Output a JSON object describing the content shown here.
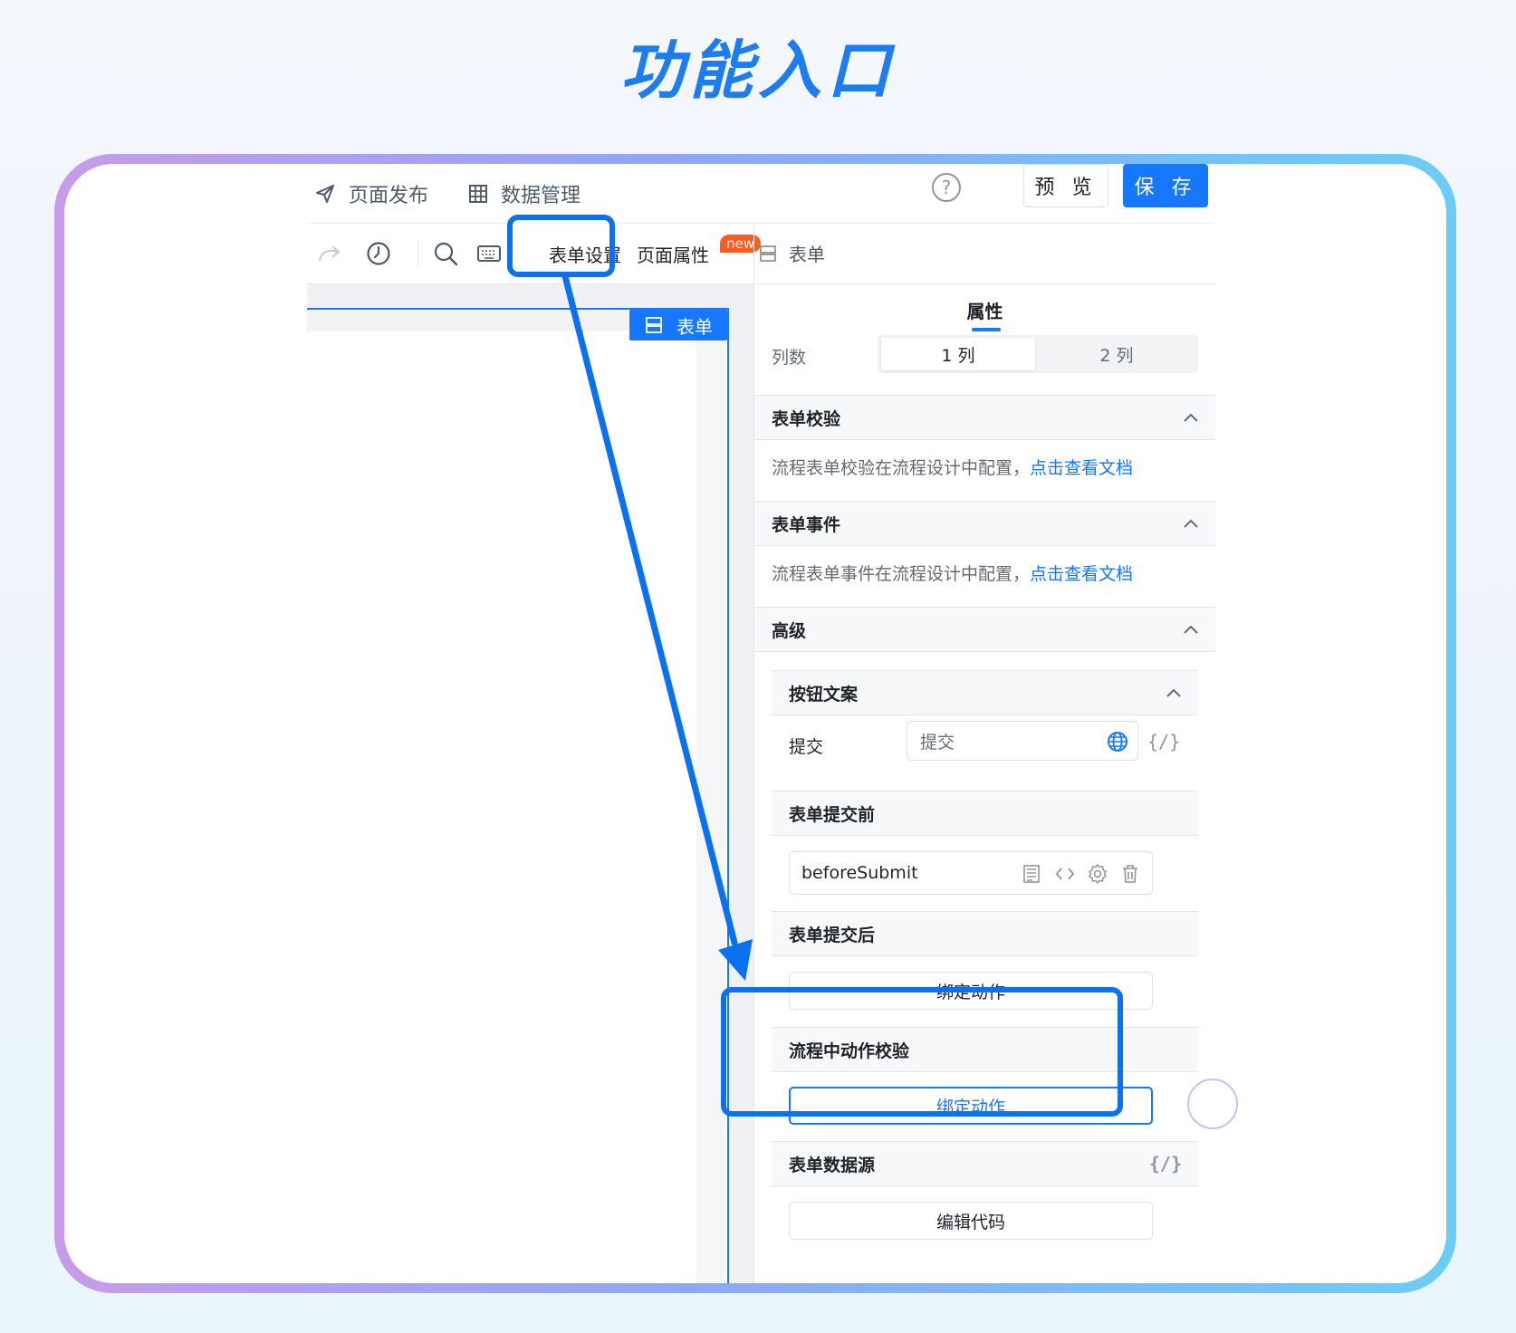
{
  "headline": "功能入口",
  "topbar": {
    "publish_label": "页面发布",
    "data_label": "数据管理",
    "help_label": "?",
    "preview_label": "预 览",
    "save_label": "保 存"
  },
  "toolbar": {
    "tab_form_settings": "表单设置",
    "tab_page_props": "页面属性",
    "new_badge": "new",
    "panel_component": "表单"
  },
  "canvas": {
    "form_tag": "表单"
  },
  "props": {
    "tab_label": "属性",
    "columns_label": "列数",
    "columns_options": [
      "1 列",
      "2 列"
    ],
    "validation": {
      "title": "表单校验",
      "text": "流程表单校验在流程设计中配置，",
      "link": "点击查看文档"
    },
    "events": {
      "title": "表单事件",
      "text": "流程表单事件在流程设计中配置，",
      "link": "点击查看文档"
    },
    "advanced": {
      "title": "高级",
      "button_copy_title": "按钮文案",
      "submit_label": "提交",
      "submit_value": "提交",
      "code_mark": "{/}",
      "before_submit_title": "表单提交前",
      "before_submit_func": "beforeSubmit",
      "after_submit_title": "表单提交后",
      "bind_action_label": "绑定动作",
      "process_validation_title": "流程中动作校验",
      "process_bind_label": "绑定动作",
      "datasource_title": "表单数据源",
      "datasource_code_mark": "{/}",
      "edit_code_label": "编辑代码"
    }
  },
  "colors": {
    "accent": "#1677ff",
    "highlight": "#0a72f0",
    "headline": "#1c7cf0",
    "badge": "#ff5a1f"
  }
}
